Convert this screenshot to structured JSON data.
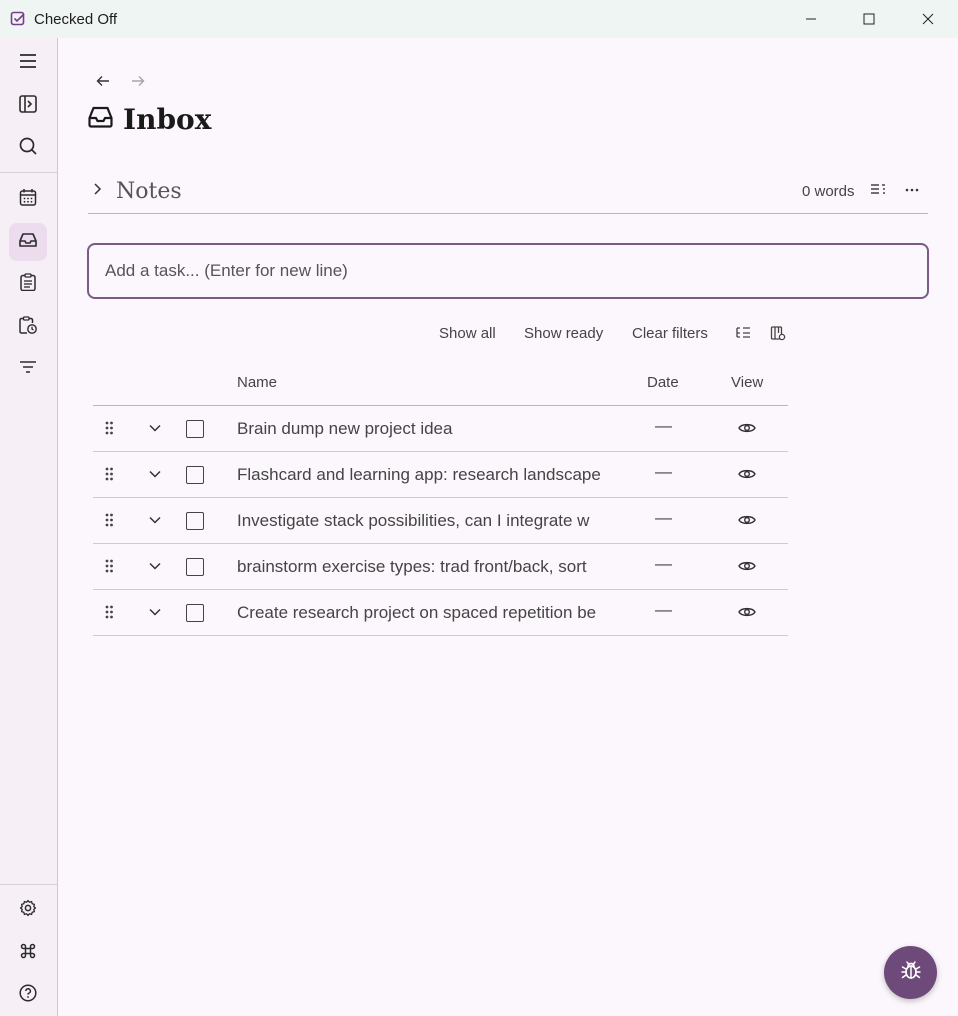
{
  "window": {
    "title": "Checked Off"
  },
  "main": {
    "page_title": "Inbox",
    "notes": {
      "title": "Notes",
      "word_count": "0 words"
    },
    "task_input": {
      "placeholder": "Add a task... (Enter for new line)"
    },
    "filters": {
      "show_all": "Show all",
      "show_ready": "Show ready",
      "clear_filters": "Clear filters"
    },
    "table": {
      "headers": {
        "name": "Name",
        "date": "Date",
        "view": "View"
      },
      "rows": [
        {
          "name": "Brain dump new project idea",
          "date": "—"
        },
        {
          "name": "Flashcard and learning app: research landscape",
          "date": "—"
        },
        {
          "name": "Investigate stack possibilities, can I integrate w",
          "date": "—"
        },
        {
          "name": "brainstorm exercise types: trad front/back, sort",
          "date": "—"
        },
        {
          "name": "Create research project on spaced repetition be",
          "date": "—"
        }
      ]
    }
  },
  "colors": {
    "accent": "#6e4a7b",
    "input_border": "#7a5a86",
    "sidebar_active": "#ecdcee"
  }
}
